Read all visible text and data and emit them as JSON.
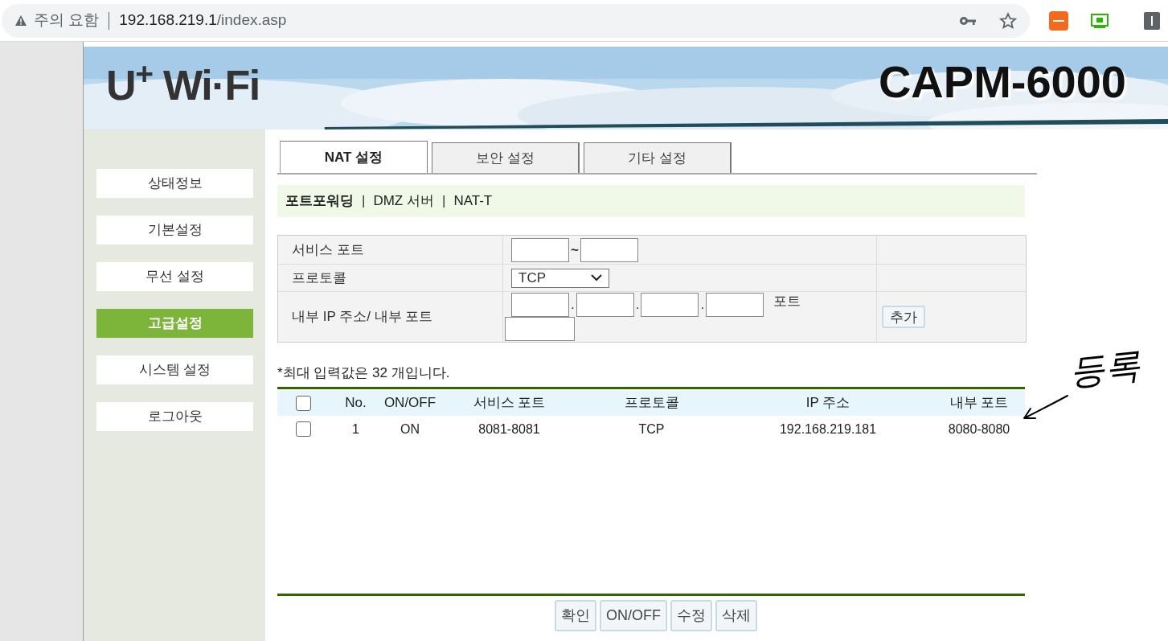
{
  "browser": {
    "security": "주의 요함",
    "url_host": "192.168.219.1",
    "url_path": "/index.asp"
  },
  "header": {
    "logo": "U$^{+}$ Wi·Fi",
    "model": "CAPM-6000"
  },
  "sidebar": {
    "items": [
      {
        "label": "상태정보",
        "selected": false
      },
      {
        "label": "기본설정",
        "selected": false
      },
      {
        "label": "무선 설정",
        "selected": false
      },
      {
        "label": "고급설정",
        "selected": true
      },
      {
        "label": "시스템 설정",
        "selected": false
      },
      {
        "label": "로그아웃",
        "selected": false
      }
    ]
  },
  "tabs": [
    {
      "label": "NAT 설정",
      "selected": true
    },
    {
      "label": "보안 설정",
      "selected": false
    },
    {
      "label": "기타 설정",
      "selected": false
    }
  ],
  "subnav_separator": [
    "|",
    "|"
  ],
  "ip_separator": [
    ".",
    ".",
    "."
  ],
  "subnav": [
    {
      "label": "포트포워딩",
      "selected": true
    },
    {
      "label": "DMZ 서버",
      "selected": false
    },
    {
      "label": "NAT-T",
      "selected": false
    }
  ],
  "form": {
    "service_port_label": "서비스 포트",
    "range_sep": "~",
    "protocol_label": "프로토콜",
    "protocol_value": "TCP",
    "internal_label": "내부 IP 주소/ 내부 포트",
    "port_label": "포트",
    "add_button": "추가"
  },
  "note": "*최대 입력값은 32 개입니다.",
  "table": {
    "columns": [
      "No.",
      "ON/OFF",
      "서비스 포트",
      "프로토콜",
      "IP 주소",
      "내부 포트"
    ],
    "all_checked": false,
    "rows": [
      {
        "checked": false,
        "cells": [
          "1",
          "ON",
          "8081-8081",
          "TCP",
          "192.168.219.181",
          "8080-8080"
        ]
      }
    ]
  },
  "buttons": [
    "확인",
    "ON/OFF",
    "수정",
    "삭제"
  ],
  "annotation": "등록"
}
